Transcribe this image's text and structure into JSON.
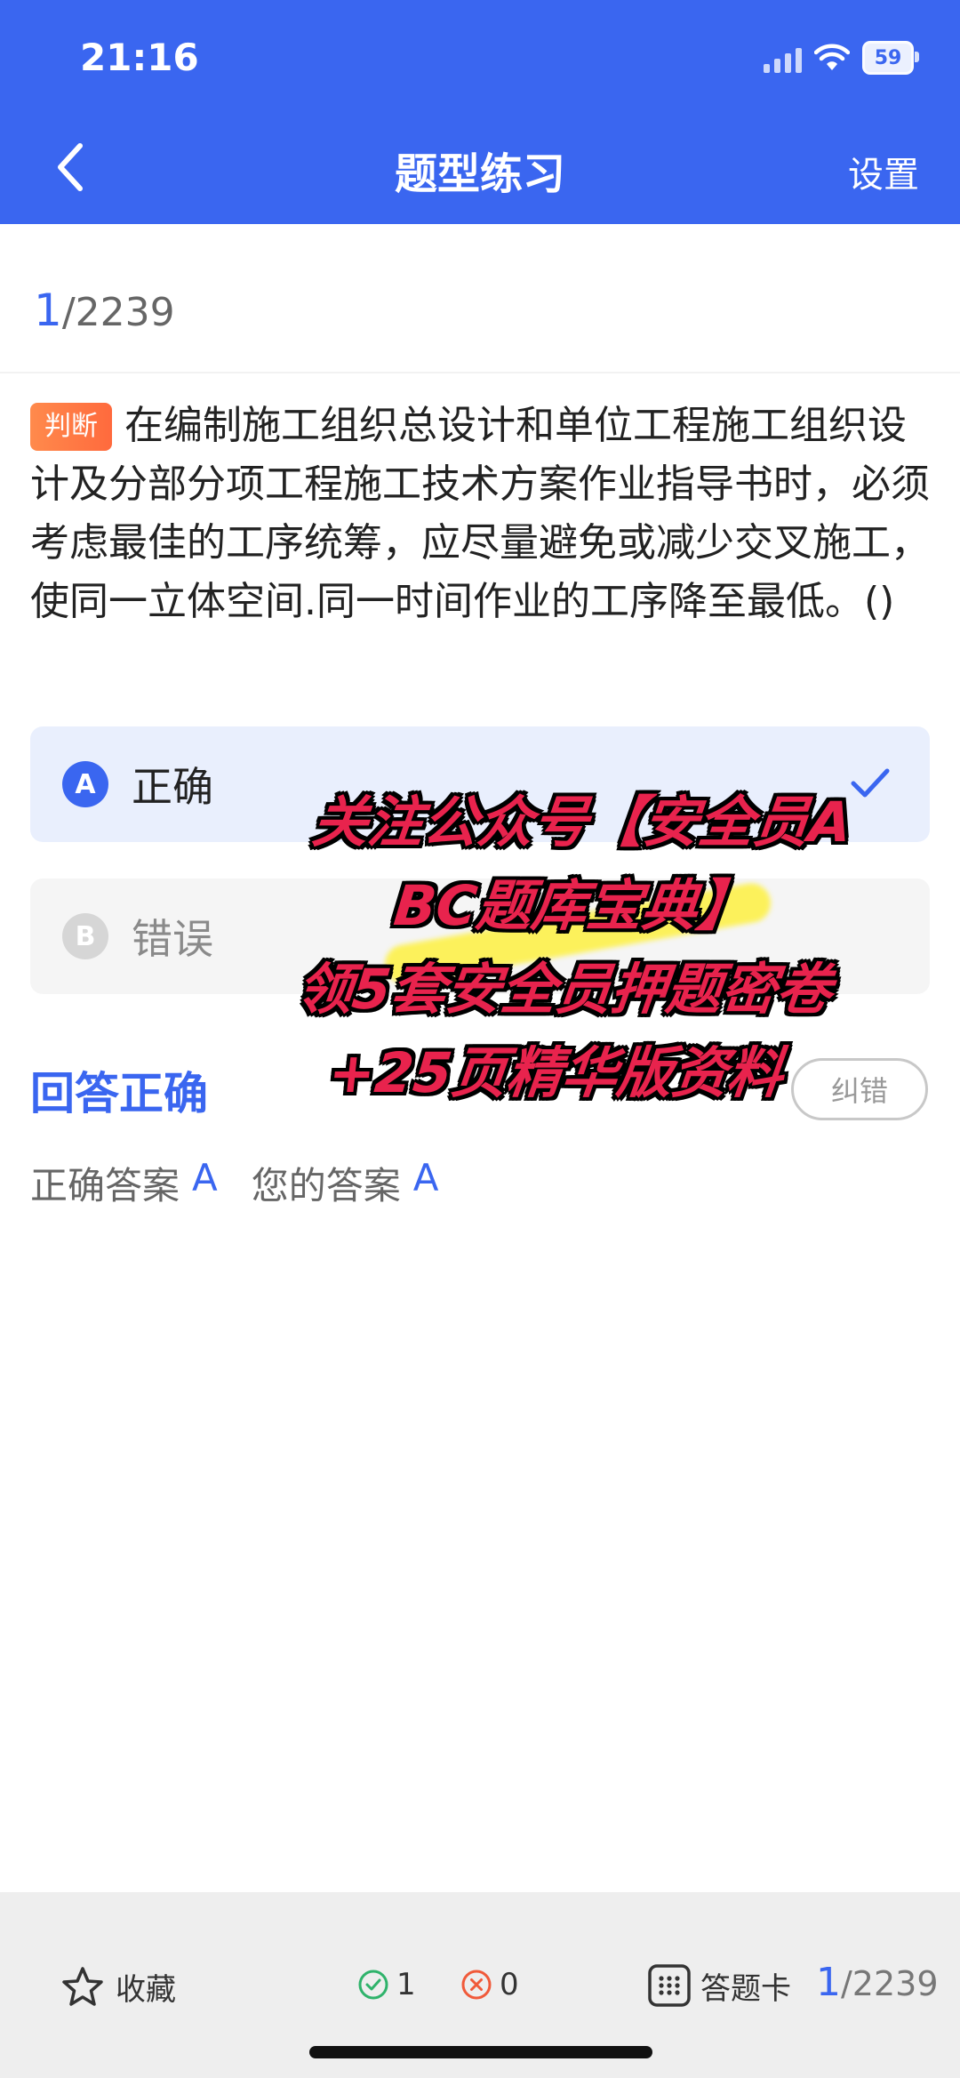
{
  "status_bar": {
    "time": "21:16",
    "battery": "59"
  },
  "header": {
    "title": "题型练习",
    "settings_label": "设置"
  },
  "counter": {
    "current": "1",
    "total": "/2239"
  },
  "question": {
    "type_badge": "判断",
    "text": "在编制施工组织总设计和单位工程施工组织设计及分部分项工程施工技术方案作业指导书时，必须考虑最佳的工序统筹，应尽量避免或减少交叉施工，使同一立体空间.同一时间作业的工序降至最低。()"
  },
  "options": [
    {
      "letter": "A",
      "label": "正确",
      "selected": true
    },
    {
      "letter": "B",
      "label": "错误",
      "selected": false
    }
  ],
  "result": {
    "status": "回答正确",
    "report_label": "纠错",
    "correct_label": "正确答案",
    "correct_value": "A",
    "yours_label": "您的答案",
    "yours_value": "A"
  },
  "promo_overlay": {
    "line1": "关注公众号【安全员A",
    "line2": "BC题库宝典】",
    "line3": "领5套安全员押题密卷",
    "line4": "+25页精华版资料"
  },
  "bottom_bar": {
    "favorite_label": "收藏",
    "right_count": "1",
    "wrong_count": "0",
    "answer_card_label": "答题卡",
    "current": "1",
    "total": "/2239"
  },
  "colors": {
    "accent": "#3a66f0",
    "badge": "#ff7a45",
    "promo": "#e8234d"
  }
}
